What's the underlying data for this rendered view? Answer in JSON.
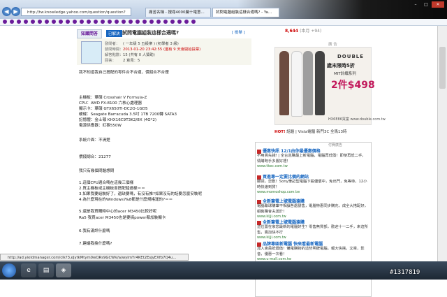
{
  "browser": {
    "address": "http://tw.knowledge.yahoo.com/question/question?",
    "tabs": [
      "痛苦名稱 - 搜尋4000屬十電意...",
      "試問電腦組裝這樣合適嗎? - Ya..."
    ],
    "controls": [
      "–",
      "□",
      "✕"
    ]
  },
  "question": {
    "site_logo": "知識問答",
    "tag": "已解決",
    "title": "試問電腦組裝這樣合適嗎?",
    "report": "[ 檢舉 ]",
    "asker": "發問者：",
    "asker_value": "( 一年級 5 五級樂 ) (初學者 3 級)",
    "time_label": "發問時間：",
    "time_value": "2013-01-20 23:42:55 (還有 9 天會開始投票)",
    "points_label": "解答點數：",
    "points_value": "15 (共有 0 人贊助)",
    "reply_label": "回答：",
    "reply_value": "2   意見：5",
    "body": [
      "我不知道我自己搭配的零件合不合適，價錢合不合理",
      "",
      "主機板：華碩 Crosshair V Formula-Z",
      "CPU：AMD FX-8100 六核心處理器",
      "顯示卡：華碩 GTX650TI-DC2O-1GD5",
      "硬碟：Seagate Barracuda 3.5吋 1TB 7200轉 SATA3",
      "記憶體：金士頓 KHX16C9T3K2/8X (4G*2)",
      "電源供應器：紅事550W",
      "",
      "系統介面：不清楚",
      "",
      "價錢總合：21277",
      "",
      "我只有幾個問題想問",
      "",
      "1.這個CPU適合嗎在這幾三個樣",
      "2.買主機板或主機板會搭配錯過樣＝＝",
      "3.如果我要組裝好了，還缺要嗎，有沒有推?如果沒有的話要怎麼安裝呢",
      "4.為什麼現在的Windows7&8都是什麼規格運的?＝＝",
      "",
      "5.還是我買購時中心的acer M3450比較好呢",
      "Ra5 我買acer M3450也是要搞power都加裝顯卡",
      "",
      "6.我有滿評什麼嗎",
      "",
      "7.建議我換什麼嗎?"
    ]
  },
  "status_bar": "http://ad.yieldmanager.com/clk?3,eJytkMtym0wQRs9GCWV/a/wyImYr4KEt2EsJyEXfb7Q4u...",
  "sidebar": {
    "points": "8,644",
    "points_extra": "(本月 +94)",
    "ad_label": "廣 告",
    "ad_brand": "DOUBLE",
    "ad_headline": "歲末限時5折",
    "ad_sub": "MIT針織系列",
    "ad_price": "2件$498",
    "ad_url": "HX6E86買童 www.double.com.tw",
    "hot_label": "HOT!",
    "hot_text": "話題 | Vista電腦 新門3C 全馬13時",
    "sponsor_title": "付費廣告",
    "items": [
      {
        "head": "優惠快訊 12/1由你最優惠價格",
        "text": "不用貨先錢! | 全台巡購最上新電腦，電腦再低價！即使再低二手，情購既手多置好禮！",
        "url": "www.tkec.com.tw"
      },
      {
        "head": "買進專一定要比價的網站",
        "text": "顯領，您數！Sony筆記型電腦下殺優價中，免出門，免等待，12小時快速到貨！",
        "url": "www.momoshop.com.tw"
      },
      {
        "head": "全新筆電上號電腦搶購",
        "text": "電腦聯球購筆不相讓各處發售，電腦特惠同步購充，成全大搭配好，組裝購會夫送於！",
        "url": "www.kijji.com.tw"
      },
      {
        "head": "全新筆電上號電腦搶購",
        "text": "這位置在家您最新的電腦好生？零售無買部，歡迎十一二手，來這所售，賣加快不行",
        "url": "www.kijji.com.tw"
      },
      {
        "head": "品牌專區新電腦 快來看最新電腦",
        "text": "加入會員抵價值！備電購物的這些明牌電腦，報大快搭，文章，影音，優惠一次看！",
        "url": "www.u-mall.com.tw"
      }
    ]
  },
  "watermark": "#1317819"
}
